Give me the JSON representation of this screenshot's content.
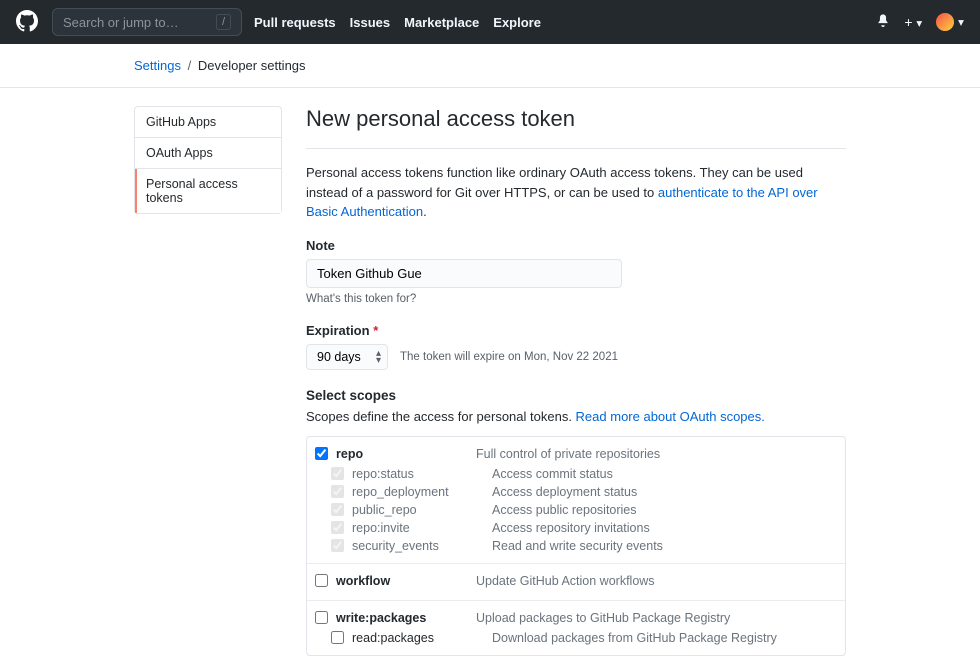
{
  "header": {
    "search_placeholder": "Search or jump to…",
    "nav": [
      "Pull requests",
      "Issues",
      "Marketplace",
      "Explore"
    ]
  },
  "breadcrumb": {
    "root": "Settings",
    "current": "Developer settings"
  },
  "sidebar": {
    "items": [
      "GitHub Apps",
      "OAuth Apps",
      "Personal access tokens"
    ],
    "active_index": 2
  },
  "page": {
    "title": "New personal access token",
    "intro_pre": "Personal access tokens function like ordinary OAuth access tokens. They can be used instead of a password for Git over HTTPS, or can be used to ",
    "intro_link": "authenticate to the API over Basic Authentication",
    "note_label": "Note",
    "note_value": "Token Github Gue",
    "note_help": "What's this token for?",
    "exp_label": "Expiration",
    "exp_value": "90 days",
    "exp_hint": "The token will expire on Mon, Nov 22 2021",
    "scopes_label": "Select scopes",
    "scopes_desc": "Scopes define the access for personal tokens. ",
    "scopes_link": "Read more about OAuth scopes."
  },
  "scopes": [
    {
      "name": "repo",
      "desc": "Full control of private repositories",
      "checked": true,
      "children_disabled": true,
      "children": [
        {
          "name": "repo:status",
          "desc": "Access commit status"
        },
        {
          "name": "repo_deployment",
          "desc": "Access deployment status"
        },
        {
          "name": "public_repo",
          "desc": "Access public repositories"
        },
        {
          "name": "repo:invite",
          "desc": "Access repository invitations"
        },
        {
          "name": "security_events",
          "desc": "Read and write security events"
        }
      ]
    },
    {
      "name": "workflow",
      "desc": "Update GitHub Action workflows",
      "checked": false,
      "children_disabled": false,
      "children": []
    },
    {
      "name": "write:packages",
      "desc": "Upload packages to GitHub Package Registry",
      "checked": false,
      "children_disabled": false,
      "children": [
        {
          "name": "read:packages",
          "desc": "Download packages from GitHub Package Registry"
        }
      ]
    }
  ]
}
